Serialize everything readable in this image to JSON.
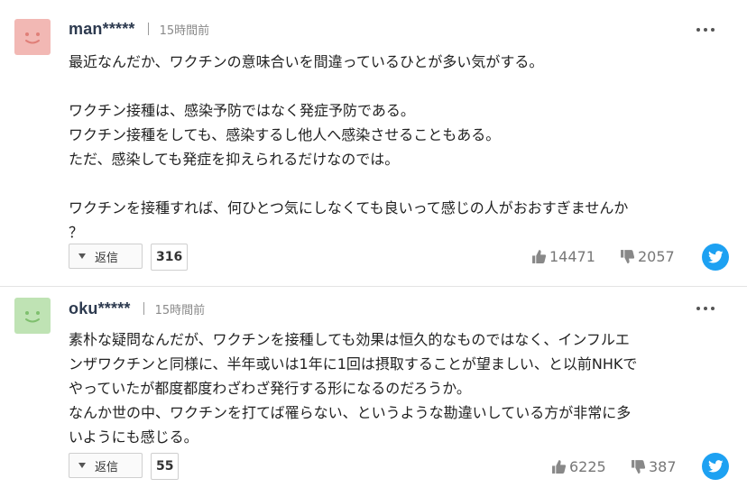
{
  "comments": [
    {
      "username": "man*****",
      "time": "15時間前",
      "avatar_color": "#f2b8b4",
      "avatar_face": "#e07f78",
      "lines": [
        "最近なんだか、ワクチンの意味合いを間違っているひとが多い気がする。",
        "",
        "ワクチン接種は、感染予防ではなく発症予防である。",
        "ワクチン接種をしても、感染するし他人へ感染させることもある。",
        "ただ、感染しても発症を抑えられるだけなのでは。",
        "",
        "ワクチンを接種すれば、何ひとつ気にしなくても良いって感じの人がおおすぎませんか",
        "？"
      ],
      "reply_label": "返信",
      "reply_count": "316",
      "likes": "14471",
      "dislikes": "2057"
    },
    {
      "username": "oku*****",
      "time": "15時間前",
      "avatar_color": "#bfe3b4",
      "avatar_face": "#7fbf6e",
      "lines": [
        "素朴な疑問なんだが、ワクチンを接種しても効果は恒久的なものではなく、インフルエ",
        "ンザワクチンと同様に、半年或いは1年に1回は摂取することが望ましい、と以前NHKで",
        "やっていたが都度都度わざわざ発行する形になるのだろうか。",
        "なんか世の中、ワクチンを打てば罹らない、というような勘違いしている方が非常に多",
        "いようにも感じる。"
      ],
      "reply_label": "返信",
      "reply_count": "55",
      "likes": "6225",
      "dislikes": "387"
    }
  ],
  "colors": {
    "twitter": "#1da1f2",
    "username": "#2d3a4f"
  }
}
